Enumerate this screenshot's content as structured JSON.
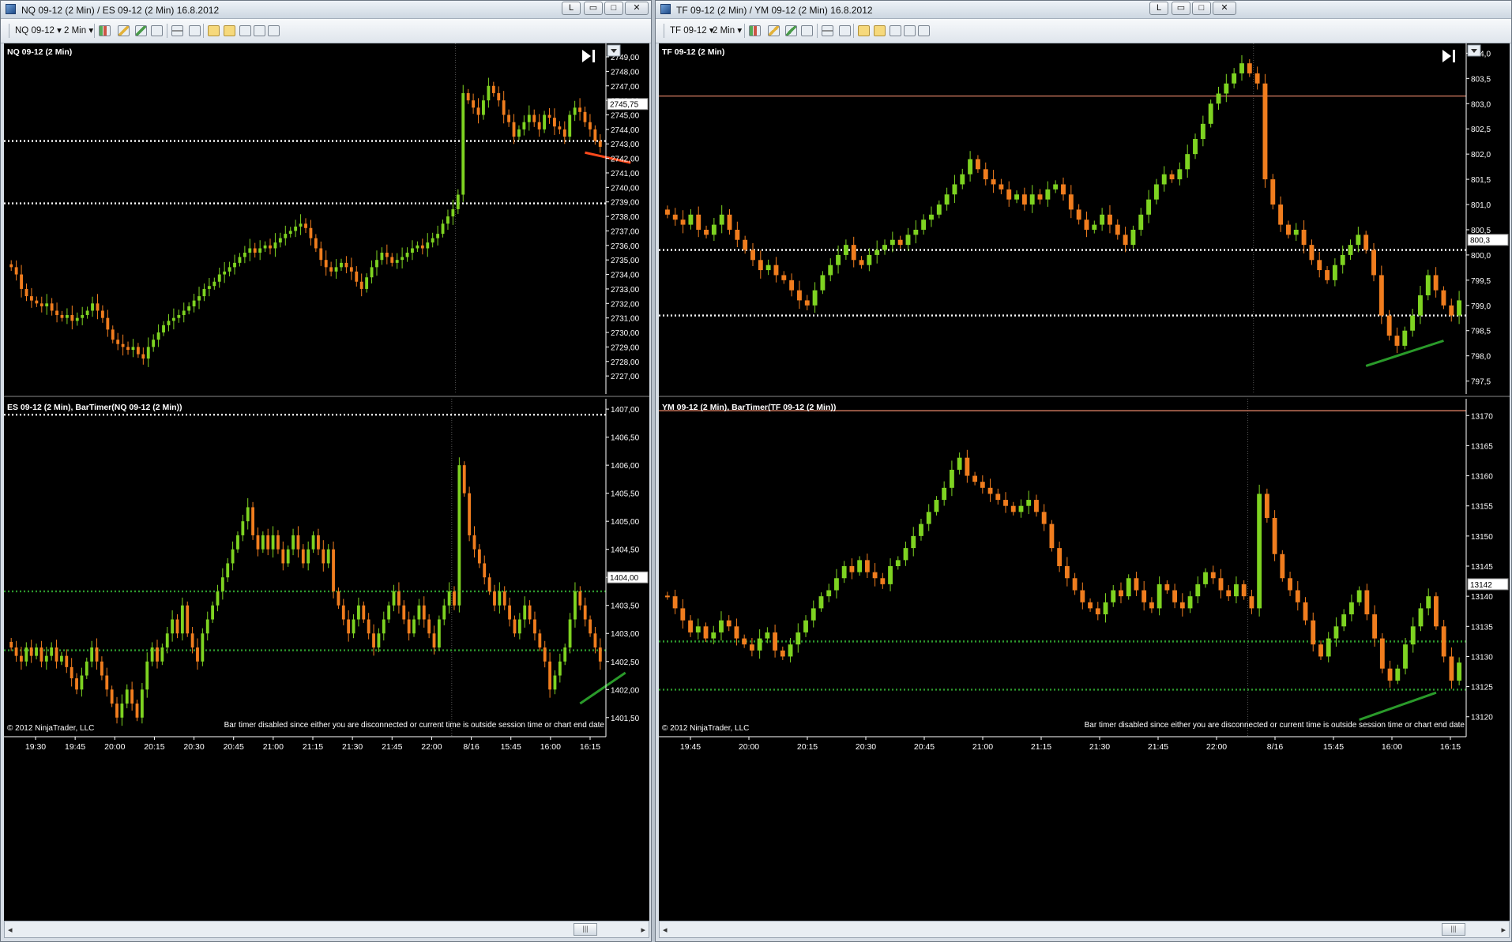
{
  "common": {
    "copyright": "© 2012 NinjaTrader, LLC",
    "bar_timer_msg": "Bar timer disabled since either you are disconnected or current time is outside session time or chart end date",
    "window_controls": {
      "badge": "L",
      "minimize": "▭",
      "maximize": "□",
      "close": "✕"
    },
    "scroll_left": "◂",
    "scroll_right": "▸",
    "scroll_thumb": "|||",
    "colors": {
      "bg": "#000000",
      "up": "#7ed321",
      "down": "#f07d1e",
      "axis_text": "#ffffff",
      "dotted_white": "#ffffff",
      "dotted_green": "#2e9a2e",
      "trend_red": "#ff4a1c",
      "trend_green": "#2a9a2a",
      "hline_salmon": "#f08c6e"
    },
    "icons": [
      "app-icon",
      "dropdown-arrow-icon",
      "bar-type-icon",
      "pencil-icon",
      "crosshair-icon",
      "zoom-icon",
      "properties-icon",
      "data-box-icon",
      "scroll-end-icon"
    ]
  },
  "windows": [
    {
      "title": "NQ 09-12 (2 Min) / ES 09-12 (2 Min)  16.8.2012",
      "toolbar": {
        "instrument": "NQ 09-12",
        "interval": "2 Min"
      },
      "x_ticks": [
        "19:30",
        "19:45",
        "20:00",
        "20:15",
        "20:30",
        "20:45",
        "21:00",
        "21:15",
        "21:30",
        "21:45",
        "22:00",
        "8/16",
        "15:45",
        "16:00",
        "16:15"
      ],
      "panels": [
        {
          "label": "NQ 09-12 (2 Min)",
          "y_ticks": [
            "2749,00",
            "2748,00",
            "2747,00",
            "2746,00",
            "2745,00",
            "2744,00",
            "2743,00",
            "2742,00",
            "2741,00",
            "2740,00",
            "2739,00",
            "2738,00",
            "2737,00",
            "2736,00",
            "2735,00",
            "2734,00",
            "2733,00",
            "2732,00",
            "2731,00",
            "2730,00",
            "2729,00",
            "2728,00",
            "2727,00"
          ],
          "y_range": [
            2726.3,
            2749.6
          ],
          "price_tag": "2745,75",
          "price_tag_value": 2745.75,
          "closes": [
            2734.5,
            2734,
            2733,
            2732.5,
            2732.2,
            2732,
            2731.8,
            2732,
            2731.5,
            2731.2,
            2731,
            2731.2,
            2730.8,
            2731,
            2731.2,
            2731.5,
            2732,
            2731.5,
            2731,
            2730.2,
            2729.5,
            2729.2,
            2729,
            2728.8,
            2729,
            2728.5,
            2728.2,
            2729,
            2729.5,
            2730,
            2730.5,
            2730.8,
            2731,
            2731.2,
            2731.5,
            2731.8,
            2732.2,
            2732.5,
            2733,
            2733.2,
            2733.5,
            2734,
            2734.2,
            2734.5,
            2734.8,
            2735.2,
            2735.5,
            2735.8,
            2735.5,
            2735.8,
            2736,
            2735.8,
            2736.2,
            2736.5,
            2736.8,
            2737,
            2737.3,
            2737.5,
            2737.2,
            2736.5,
            2735.8,
            2735,
            2734.5,
            2734.2,
            2734.5,
            2734.8,
            2734.5,
            2734.2,
            2733.5,
            2733,
            2733.8,
            2734.5,
            2735,
            2735.5,
            2735.2,
            2734.8,
            2735,
            2735.2,
            2735.5,
            2735.8,
            2736,
            2735.8,
            2736.2,
            2736.5,
            2736.8,
            2737.5,
            2738,
            2738.5,
            2739.5,
            2746.5,
            2746,
            2745.5,
            2745,
            2746,
            2747,
            2746.5,
            2746,
            2745,
            2744.5,
            2743.5,
            2744,
            2744.5,
            2745,
            2744.5,
            2744,
            2745,
            2744.8,
            2744.2,
            2744,
            2743.5,
            2745,
            2745.5,
            2745.2,
            2744.5,
            2744,
            2743.2,
            2742.8
          ],
          "levels": [
            {
              "value": 2743.2,
              "color": "#ffffff"
            },
            {
              "value": 2738.9,
              "color": "#ffffff"
            }
          ],
          "trendline": {
            "from": [
              113,
              2742.4
            ],
            "to": [
              122,
              2741.7
            ],
            "color": "#ff4a1c"
          },
          "session_break_index": 88
        },
        {
          "label": "ES 09-12 (2 Min), BarTimer(NQ 09-12 (2 Min))",
          "y_ticks": [
            "1407,00",
            "1406,50",
            "1406,00",
            "1405,50",
            "1405,00",
            "1404,50",
            "1404,00",
            "1403,50",
            "1403,00",
            "1402,50",
            "1402,00",
            "1401,50"
          ],
          "y_range": [
            1401.3,
            1407.1
          ],
          "price_tag": "1404,00",
          "price_tag_value": 1404.0,
          "closes": [
            1402.75,
            1402.6,
            1402.5,
            1402.75,
            1402.6,
            1402.75,
            1402.5,
            1402.6,
            1402.75,
            1402.5,
            1402.6,
            1402.4,
            1402.2,
            1402,
            1402.25,
            1402.5,
            1402.75,
            1402.5,
            1402.25,
            1402,
            1401.75,
            1401.5,
            1401.75,
            1402,
            1401.75,
            1401.5,
            1402,
            1402.5,
            1402.75,
            1402.5,
            1402.75,
            1403,
            1403.25,
            1403,
            1403.5,
            1403,
            1402.75,
            1402.5,
            1403,
            1403.25,
            1403.5,
            1403.75,
            1404,
            1404.25,
            1404.5,
            1404.75,
            1405,
            1405.25,
            1404.75,
            1404.5,
            1404.75,
            1404.5,
            1404.75,
            1404.5,
            1404.25,
            1404.5,
            1404.75,
            1404.5,
            1404.25,
            1404.5,
            1404.75,
            1404.5,
            1404.25,
            1404.5,
            1403.75,
            1403.5,
            1403.25,
            1403,
            1403.25,
            1403.5,
            1403.25,
            1403,
            1402.75,
            1403,
            1403.25,
            1403.5,
            1403.75,
            1403.5,
            1403.25,
            1403,
            1403.25,
            1403.5,
            1403.25,
            1403,
            1402.75,
            1403.25,
            1403.5,
            1403.75,
            1403.5,
            1406,
            1405.5,
            1404.75,
            1404.5,
            1404.25,
            1404,
            1403.75,
            1403.5,
            1403.75,
            1403.5,
            1403.25,
            1403,
            1403.25,
            1403.5,
            1403.25,
            1403,
            1402.75,
            1402.5,
            1402,
            1402.25,
            1402.5,
            1402.75,
            1403.25,
            1403.75,
            1403.5,
            1403.25,
            1403,
            1402.75,
            1402.5
          ],
          "levels": [
            {
              "value": 1406.9,
              "color": "#ffffff"
            },
            {
              "value": 1403.75,
              "color": "#2e9a2e"
            },
            {
              "value": 1402.7,
              "color": "#2e9a2e"
            }
          ],
          "trendline": {
            "from": [
              113,
              1401.75
            ],
            "to": [
              122,
              1402.3
            ],
            "color": "#2a9a2a"
          },
          "session_break_index": 88
        }
      ]
    },
    {
      "title": "TF 09-12 (2 Min) / YM 09-12 (2 Min)  16.8.2012",
      "toolbar": {
        "instrument": "TF 09-12",
        "interval": "2 Min"
      },
      "x_ticks": [
        "19:45",
        "20:00",
        "20:15",
        "20:30",
        "20:45",
        "21:00",
        "21:15",
        "21:30",
        "21:45",
        "22:00",
        "8/16",
        "15:45",
        "16:00",
        "16:15"
      ],
      "panels": [
        {
          "label": "TF 09-12 (2 Min)",
          "y_ticks": [
            "804,0",
            "803,5",
            "803,0",
            "802,5",
            "802,0",
            "801,5",
            "801,0",
            "800,5",
            "800,0",
            "799,5",
            "799,0",
            "798,5",
            "798,0",
            "797,5"
          ],
          "y_range": [
            797.4,
            804.1
          ],
          "price_tag": "800,3",
          "price_tag_value": 800.3,
          "closes": [
            800.8,
            800.7,
            800.6,
            800.8,
            800.5,
            800.4,
            800.6,
            800.8,
            800.5,
            800.3,
            800.1,
            799.9,
            799.7,
            799.8,
            799.6,
            799.5,
            799.3,
            799.1,
            799,
            799.3,
            799.6,
            799.8,
            800,
            800.2,
            799.9,
            799.8,
            800,
            800.1,
            800.2,
            800.3,
            800.2,
            800.4,
            800.5,
            800.7,
            800.8,
            801,
            801.2,
            801.4,
            801.6,
            801.9,
            801.7,
            801.5,
            801.4,
            801.3,
            801.1,
            801.2,
            801,
            801.2,
            801.1,
            801.3,
            801.4,
            801.2,
            800.9,
            800.7,
            800.5,
            800.6,
            800.8,
            800.6,
            800.4,
            800.2,
            800.5,
            800.8,
            801.1,
            801.4,
            801.6,
            801.5,
            801.7,
            802,
            802.3,
            802.6,
            803,
            803.2,
            803.4,
            803.6,
            803.8,
            803.6,
            803.4,
            801.5,
            801,
            800.6,
            800.4,
            800.5,
            800.2,
            799.9,
            799.7,
            799.5,
            799.8,
            800,
            800.2,
            800.4,
            800.1,
            799.6,
            798.8,
            798.4,
            798.2,
            798.5,
            798.8,
            799.2,
            799.6,
            799.3,
            799,
            798.8,
            799.1
          ],
          "levels": [
            {
              "value": 803.15,
              "color": "#f08c6e",
              "solid": true
            },
            {
              "value": 800.1,
              "color": "#ffffff"
            },
            {
              "value": 798.8,
              "color": "#ffffff"
            }
          ],
          "trendline": {
            "from": [
              90,
              797.8
            ],
            "to": [
              100,
              798.3
            ],
            "color": "#2a9a2a"
          },
          "session_break_index": 76
        },
        {
          "label": "YM 09-12 (2 Min), BarTimer(TF 09-12 (2 Min))",
          "y_ticks": [
            "13170",
            "13165",
            "13160",
            "13155",
            "13150",
            "13145",
            "13140",
            "13135",
            "13130",
            "13125",
            "13120"
          ],
          "y_range": [
            13118,
            13172
          ],
          "price_tag": "13142",
          "price_tag_value": 13142,
          "closes": [
            13140,
            13138,
            13136,
            13134,
            13135,
            13133,
            13134,
            13136,
            13135,
            13133,
            13132,
            13131,
            13133,
            13134,
            13131,
            13130,
            13132,
            13134,
            13136,
            13138,
            13140,
            13141,
            13143,
            13145,
            13144,
            13146,
            13144,
            13143,
            13142,
            13145,
            13146,
            13148,
            13150,
            13152,
            13154,
            13156,
            13158,
            13161,
            13163,
            13160,
            13159,
            13158,
            13157,
            13156,
            13155,
            13154,
            13155,
            13156,
            13154,
            13152,
            13148,
            13145,
            13143,
            13141,
            13139,
            13138,
            13137,
            13139,
            13141,
            13140,
            13143,
            13141,
            13139,
            13138,
            13142,
            13141,
            13139,
            13138,
            13140,
            13142,
            13144,
            13143,
            13141,
            13140,
            13142,
            13140,
            13138,
            13157,
            13153,
            13147,
            13143,
            13141,
            13139,
            13136,
            13132,
            13130,
            13133,
            13135,
            13137,
            13139,
            13141,
            13137,
            13133,
            13128,
            13126,
            13128,
            13132,
            13135,
            13138,
            13140,
            13135,
            13130,
            13126,
            13129
          ],
          "levels": [
            {
              "value": 13170.8,
              "color": "#f08c6e",
              "solid": true
            },
            {
              "value": 13132.5,
              "color": "#2e9a2e"
            },
            {
              "value": 13124.5,
              "color": "#2e9a2e"
            }
          ],
          "trendline": {
            "from": [
              90,
              13119.5
            ],
            "to": [
              100,
              13124
            ],
            "color": "#2a9a2a"
          },
          "session_break_index": 76
        }
      ]
    }
  ]
}
